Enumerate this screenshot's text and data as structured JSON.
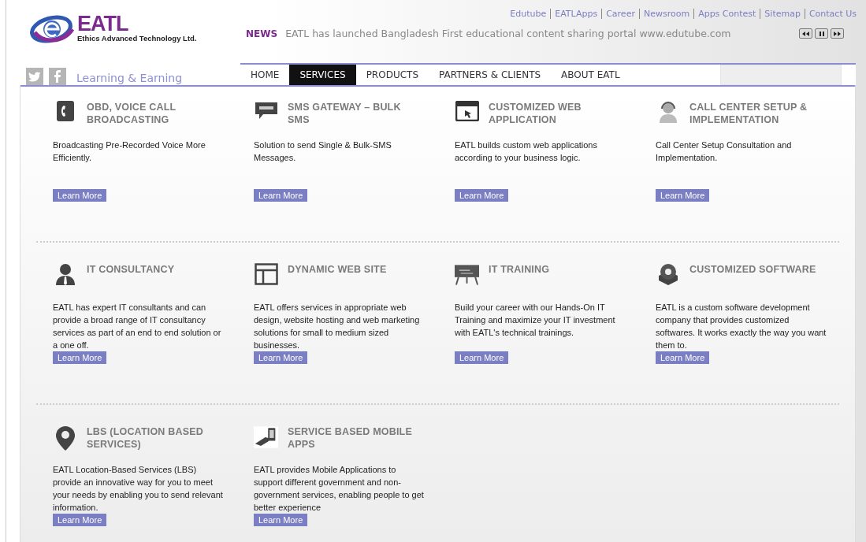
{
  "logo": {
    "mark": "EATL",
    "subtitle": "Ethics Advanced Technology Ltd."
  },
  "top_links": [
    "Edutube",
    "EATLApps",
    "Career",
    "Newsroom",
    "Apps Contest",
    "Sitemap",
    "Contact Us"
  ],
  "news": {
    "label": "NEWS",
    "text": "EATL has launched Bangladesh First educational content sharing portal www.edutube.com"
  },
  "tagline": "Learning & Earning",
  "nav": [
    {
      "label": "HOME",
      "selected": false
    },
    {
      "label": "SERVICES",
      "selected": true
    },
    {
      "label": "PRODUCTS",
      "selected": false
    },
    {
      "label": "PARTNERS & CLIENTS",
      "selected": false
    },
    {
      "label": "ABOUT EATL",
      "selected": false
    }
  ],
  "services": [
    [
      {
        "kind": "phone",
        "title": "OBD, VOICE CALL BROADCASTING",
        "description": "Broadcasting Pre-Recorded Voice More Efficiently.",
        "button": "Learn More"
      },
      {
        "kind": "sms",
        "title": "SMS GATEWAY – BULK SMS",
        "description": "Solution to send Single & Bulk-SMS Messages.",
        "button": "Learn More"
      },
      {
        "kind": "browser",
        "title": "CUSTOMIZED WEB APPLICATION",
        "description": "EATL builds custom web applications according to your business logic.",
        "button": "Learn More"
      },
      {
        "kind": "agent",
        "title": "CALL CENTER SETUP & IMPLEMENTATION",
        "description": "Call Center Setup Consultation and Implementation.",
        "button": "Learn More"
      }
    ],
    [
      {
        "kind": "person",
        "title": "IT CONSULTANCY",
        "description": "EATL has expert IT consultants and can provide a broad range of IT consultancy services as part of an end to end solution or a one off.",
        "button": "Learn More"
      },
      {
        "kind": "layout",
        "title": "DYNAMIC WEB SITE",
        "description": "EATL offers services in appropriate web design, website hosting and web marketing solutions for small to medium sized businesses.",
        "button": "Learn More"
      },
      {
        "kind": "board",
        "title": "IT TRAINING",
        "description": "Build your career with our Hands-On IT Training and maximize your IT investment with EATL's technical trainings.",
        "button": "Learn More"
      },
      {
        "kind": "disc",
        "title": "CUSTOMIZED SOFTWARE",
        "description": "EATL is a custom software development company that provides customized softwares. It works exactly the way you want them to.",
        "button": "Learn More"
      }
    ],
    [
      {
        "kind": "pin",
        "title": "LBS (LOCATION BASED SERVICES)",
        "description": "EATL Location-Based Services (LBS) provide an innovative way for you to meet your needs by enabling you to send relevant information.",
        "button": "Learn More"
      },
      {
        "kind": "mobile",
        "title": "SERVICE BASED MOBILE APPS",
        "description": "EATL provides Mobile Applications to support different government and non-government services, enabling people to get better experience",
        "button": "Learn More"
      }
    ]
  ]
}
